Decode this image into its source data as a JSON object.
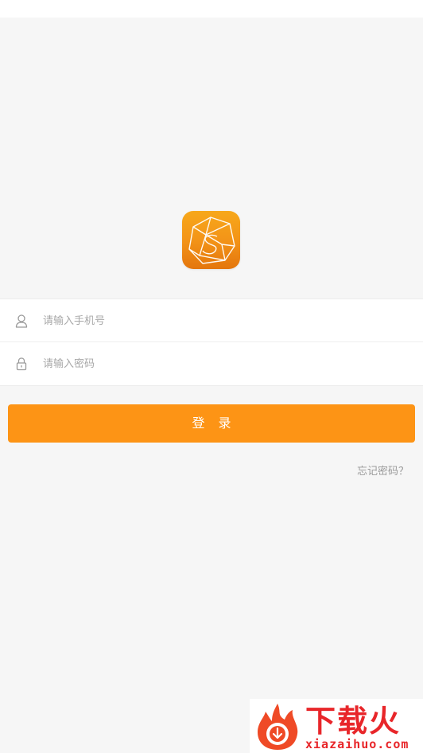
{
  "login": {
    "phone_placeholder": "请输入手机号",
    "password_placeholder": "请输入密码",
    "login_label": "登 录",
    "forgot_label": "忘记密码？"
  },
  "icons": {
    "phone_field": "user-icon",
    "password_field": "lock-icon",
    "app_logo": "faceted-gem-s-logo"
  },
  "colors": {
    "primary": "#fd9415",
    "logo_top": "#f7a81a",
    "logo_bottom": "#e4760d",
    "background": "#f6f6f6",
    "placeholder": "#a8a8a8",
    "link": "#9a9a9a",
    "watermark": "#e8262a"
  },
  "watermark": {
    "title": "下载火",
    "url": "xiazaihuo.com"
  }
}
